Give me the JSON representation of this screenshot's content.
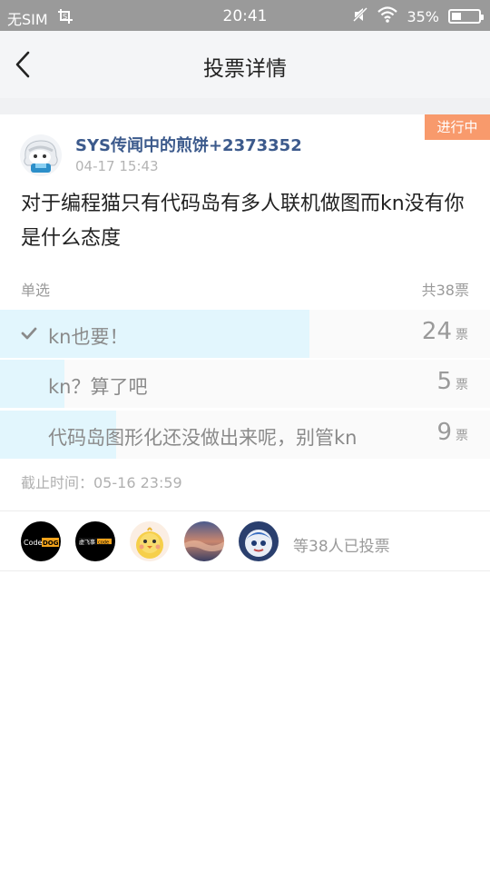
{
  "status_bar": {
    "carrier": "无SIM",
    "time": "20:41",
    "battery_percent": "35%",
    "battery_level": 0.35
  },
  "header": {
    "title": "投票详情"
  },
  "post": {
    "status_tag": "进行中",
    "username": "SYS传闻中的煎饼+2373352",
    "time": "04-17 15:43",
    "question": "对于编程猫只有代码岛有多人联机做图而kn没有你是什么态度"
  },
  "poll": {
    "type_label": "单选",
    "total_label": "共38票",
    "options": [
      {
        "label": "kn也要！",
        "votes": "24",
        "unit": "票",
        "selected": true,
        "fraction": 0.632
      },
      {
        "label": "kn？算了吧",
        "votes": "5",
        "unit": "票",
        "selected": false,
        "fraction": 0.132
      },
      {
        "label": "代码岛图形化还没做出来呢，别管kn",
        "votes": "9",
        "unit": "票",
        "selected": false,
        "fraction": 0.237
      }
    ],
    "deadline": "截止时间：05-16 23:59"
  },
  "voters": {
    "text": "等38人已投票",
    "avatars": [
      {
        "icon": "codedog-avatar",
        "text": "Code DOG"
      },
      {
        "icon": "codecraft-avatar",
        "text": "虚飞事code"
      },
      {
        "icon": "chick-avatar"
      },
      {
        "icon": "sky-avatar"
      },
      {
        "icon": "mascot-avatar"
      }
    ]
  },
  "colors": {
    "accent_tag": "#f89a6c",
    "username": "#3c5a8c",
    "bar_fill": "#e2f6fd"
  }
}
